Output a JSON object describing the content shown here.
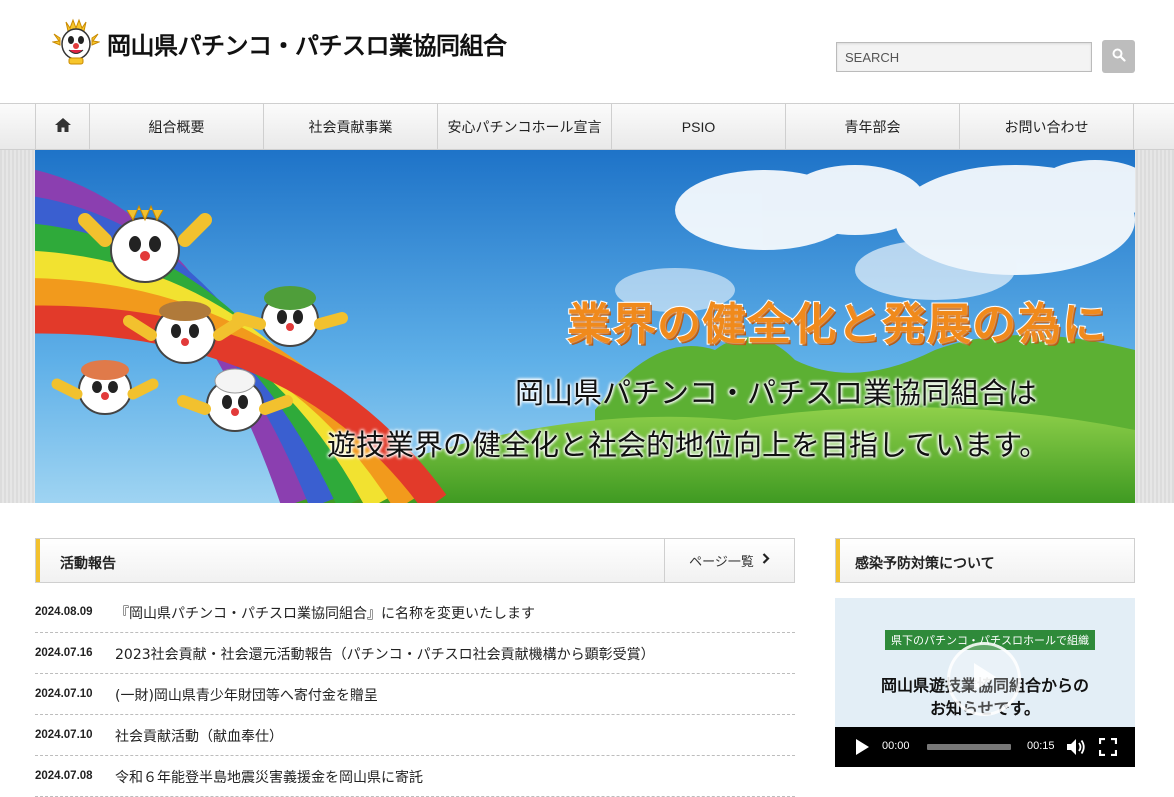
{
  "header": {
    "site_title": "岡山県パチンコ・パチスロ業協同組合",
    "logo_icon": "mascot-logo-icon",
    "search": {
      "placeholder": "SEARCH",
      "button_icon": "search-icon"
    }
  },
  "nav": {
    "home_icon": "home-icon",
    "items": [
      {
        "label": "組合概要"
      },
      {
        "label": "社会貢献事業"
      },
      {
        "label": "安心パチンコホール宣言"
      },
      {
        "label": "PSIO"
      },
      {
        "label": "青年部会"
      },
      {
        "label": "お問い合わせ"
      }
    ]
  },
  "hero": {
    "headline": "業界の健全化と発展の為に",
    "line1": "岡山県パチンコ・パチスロ業協同組合は",
    "line2": "遊技業界の健全化と社会的地位向上を目指しています。"
  },
  "news": {
    "title": "活動報告",
    "page_list_label": "ページ一覧",
    "items": [
      {
        "date": "2024.08.09",
        "title": "『岡山県パチンコ・パチスロ業協同組合』に名称を変更いたします"
      },
      {
        "date": "2024.07.16",
        "title": "2023社会貢献・社会還元活動報告（パチンコ・パチスロ社会貢献機構から顕彰受賞）"
      },
      {
        "date": "2024.07.10",
        "title": "(一財)岡山県青少年財団等へ寄付金を贈呈"
      },
      {
        "date": "2024.07.10",
        "title": "社会貢献活動（献血奉仕）"
      },
      {
        "date": "2024.07.08",
        "title": "令和６年能登半島地震災害義援金を岡山県に寄託"
      }
    ]
  },
  "sidebar": {
    "title": "感染予防対策について",
    "video": {
      "tag": "県下のパチンコ・パチスロホールで組織",
      "text1": "岡山県遊技業協同組合からの",
      "text2": "お知らせです。",
      "time_current": "00:00",
      "time_total": "00:15"
    }
  },
  "colors": {
    "accent": "#f2c12e",
    "nav_bg": "#eeeeee",
    "headline": "#f08a1c"
  }
}
